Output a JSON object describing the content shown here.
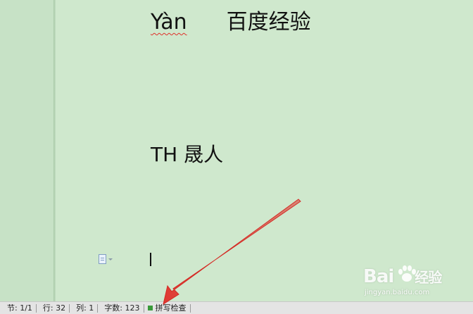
{
  "document": {
    "line1_latin": "Yàn",
    "line1_cjk": "百度经验",
    "line2_latin": "TH",
    "line2_cjk": "晟人"
  },
  "status_bar": {
    "section": "节: 1/1",
    "row": "行: 32",
    "column": "列: 1",
    "word_count": "字数: 123",
    "spell_check": "拼写检查",
    "spell_check_color": "#3a9a3a"
  },
  "watermark": {
    "logo_text": "Bai",
    "logo_suffix": "经验",
    "url": "jingyan.baidu.com"
  },
  "annotation": {
    "arrow_color": "#e0302a"
  }
}
